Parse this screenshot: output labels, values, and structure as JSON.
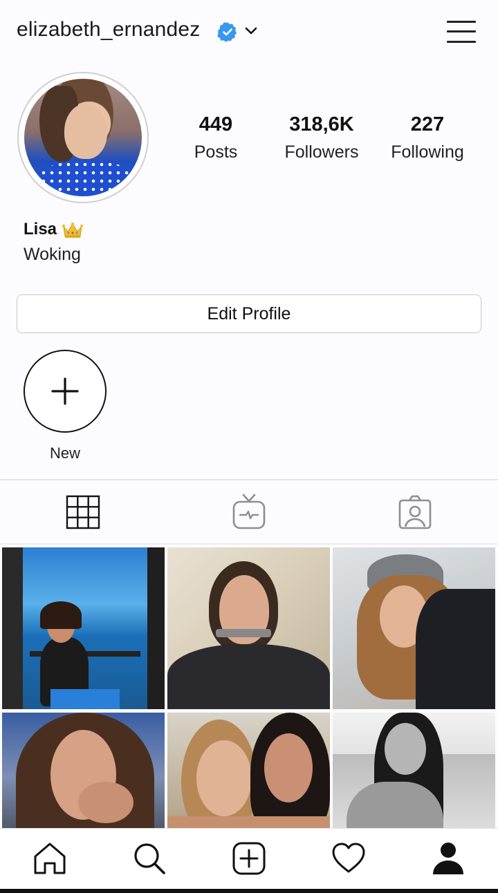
{
  "header": {
    "username": "elizabeth_ernandez",
    "verified_icon": "verified-badge-icon",
    "dropdown_icon": "chevron-down-icon",
    "menu_icon": "hamburger-menu-icon"
  },
  "profile": {
    "stats": [
      {
        "value": "449",
        "label": "Posts"
      },
      {
        "value": "318,6K",
        "label": "Followers"
      },
      {
        "value": "227",
        "label": "Following"
      }
    ],
    "name": "Lisa",
    "name_emoji": "crown-icon",
    "bio": "Woking",
    "edit_button": "Edit Profile"
  },
  "highlights": {
    "new_label": "New"
  },
  "tabs": [
    {
      "icon": "grid-icon",
      "active": true
    },
    {
      "icon": "igtv-icon",
      "active": false
    },
    {
      "icon": "tagged-icon",
      "active": false
    }
  ],
  "colors": {
    "verified": "#3897f0",
    "text": "#111111",
    "inactive_icon": "#8e8e8e",
    "background": "#fcfbfd"
  },
  "bottom_nav": [
    {
      "icon": "home-icon"
    },
    {
      "icon": "search-icon"
    },
    {
      "icon": "new-post-icon"
    },
    {
      "icon": "heart-icon"
    },
    {
      "icon": "profile-icon",
      "active": true
    }
  ]
}
